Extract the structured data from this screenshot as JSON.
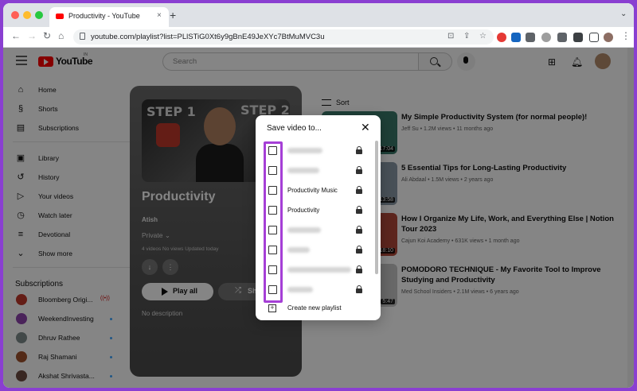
{
  "browser": {
    "tab_title": "Productivity - YouTube",
    "tab_close": "×",
    "new_tab": "+",
    "url": "youtube.com/playlist?list=PLlSTiG0Xt6y9gBnE49JeXYc7BtMuMVC3u",
    "back": "←",
    "forward": "→",
    "reload": "↻",
    "home": "⌂"
  },
  "youtube": {
    "logo_text": "YouTube",
    "logo_region": "IN",
    "search_placeholder": "Search"
  },
  "sidebar": {
    "items": [
      {
        "label": "Home",
        "icon": "⌂"
      },
      {
        "label": "Shorts",
        "icon": "§"
      },
      {
        "label": "Subscriptions",
        "icon": "▤"
      }
    ],
    "library_items": [
      {
        "label": "Library",
        "icon": "▣"
      },
      {
        "label": "History",
        "icon": "↺"
      },
      {
        "label": "Your videos",
        "icon": "▷"
      },
      {
        "label": "Watch later",
        "icon": "◷"
      },
      {
        "label": "Devotional",
        "icon": "≡"
      },
      {
        "label": "Show more",
        "icon": "⌄"
      }
    ],
    "subscriptions_heading": "Subscriptions",
    "subscriptions": [
      {
        "name": "Bloomberg Origi...",
        "color": "#c0392b",
        "live": "((•))"
      },
      {
        "name": "WeekendInvesting",
        "color": "#8e44ad"
      },
      {
        "name": "Dhruv Rathee",
        "color": "#7f8c8d"
      },
      {
        "name": "Raj Shamani",
        "color": "#a0522d"
      },
      {
        "name": "Akshat Shrivasta...",
        "color": "#6d4c41"
      }
    ]
  },
  "playlist": {
    "thumb_text_left": "STEP 1",
    "thumb_text_right": "STEP 2",
    "title": "Productivity",
    "owner": "Atish",
    "privacy": "Private",
    "meta": "4 videos  No views  Updated today",
    "play_all": "Play all",
    "shuffle": "Shuffle",
    "description": "No description",
    "download_icon": "↓",
    "more_icon": "⋮"
  },
  "sort_label": "Sort",
  "videos": [
    {
      "title": "My Simple Productivity System (for normal people)!",
      "meta": "Jeff Su • 1.2M views • 11 months ago",
      "duration": "17:04",
      "color": "#3a7a6a"
    },
    {
      "title": "5 Essential Tips for Long-Lasting Productivity",
      "meta": "Ali Abdaal • 1.5M views • 2 years ago",
      "duration": "13:58",
      "color": "#8a9aa8"
    },
    {
      "title": "How I Organize My Life, Work, and Everything Else | Notion Tour 2023",
      "meta": "Cajun Koi Academy • 631K views • 1 month ago",
      "duration": "18:10",
      "color": "#b24a3a"
    },
    {
      "title": "POMODORO TECHNIQUE - My Favorite Tool to Improve Studying and Productivity",
      "meta": "Med School Insiders • 2.1M views • 6 years ago",
      "duration": "5:47",
      "color": "#c8c8c8"
    }
  ],
  "dialog": {
    "title": "Save video to...",
    "close": "✕",
    "rows": [
      {
        "label": "",
        "blur_width": 44
      },
      {
        "label": "",
        "blur_width": 40
      },
      {
        "label": "Productivity Music"
      },
      {
        "label": "Productivity"
      },
      {
        "label": "",
        "blur_width": 42
      },
      {
        "label": "",
        "blur_width": 28
      },
      {
        "label": "",
        "blur_width": 80
      },
      {
        "label": "",
        "blur_width": 32
      }
    ],
    "create_label": "Create new playlist",
    "highlight_color": "#a53fd6"
  }
}
